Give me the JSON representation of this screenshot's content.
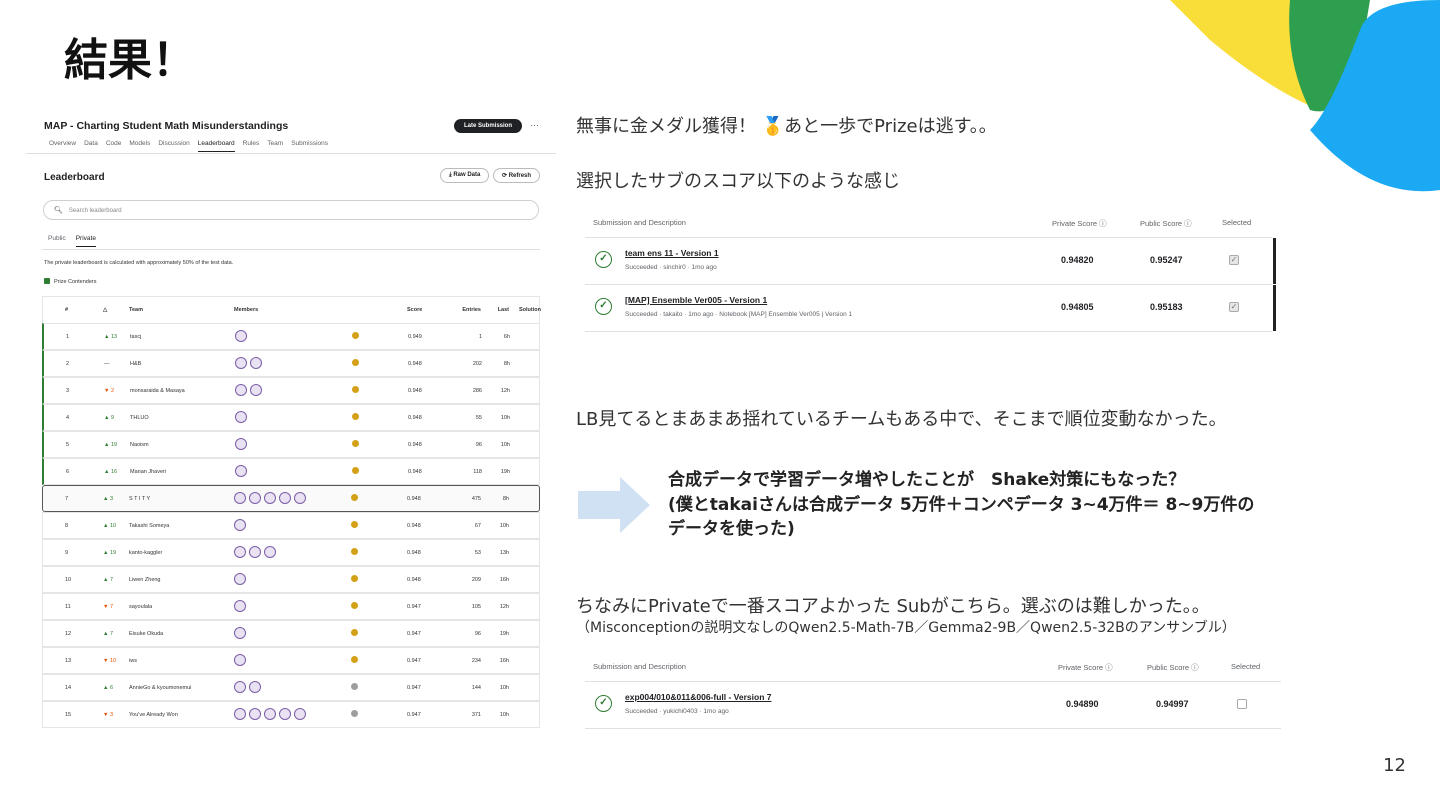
{
  "slide": {
    "title": "結果！",
    "page_number": "12"
  },
  "colors": {
    "yellow": "#f9de3a",
    "green": "#2e9e4f",
    "blue": "#1aa9f2",
    "arrow": "#cfe1f3",
    "prize_green": "#2e7d32"
  },
  "leaderboard": {
    "competition_title": "MAP - Charting Student Math Misunderstandings",
    "late_submission_label": "Late Submission",
    "more_label": "···",
    "tabs": [
      "Overview",
      "Data",
      "Code",
      "Models",
      "Discussion",
      "Leaderboard",
      "Rules",
      "Team",
      "Submissions"
    ],
    "active_tab": "Leaderboard",
    "heading": "Leaderboard",
    "raw_data_label": "⤓ Raw Data",
    "refresh_label": "⟳ Refresh",
    "search_placeholder": "Search leaderboard",
    "sub_tabs": [
      "Public",
      "Private"
    ],
    "note": "The private leaderboard is calculated with approximately 50% of the test data.",
    "prize_label": "Prize Contenders",
    "columns": [
      "#",
      "△",
      "Team",
      "Members",
      "Score",
      "Entries",
      "Last",
      "Solution"
    ],
    "rows": [
      {
        "rank": "1",
        "delta": "▲ 13",
        "dir": "up",
        "team": "tascj",
        "members": 1,
        "medal": "gold",
        "score": "0.949",
        "entries": "1",
        "last": "6h",
        "prize": true
      },
      {
        "rank": "2",
        "delta": "—",
        "dir": "none",
        "team": "H&B",
        "members": 2,
        "medal": "gold",
        "score": "0.948",
        "entries": "202",
        "last": "8h",
        "prize": true
      },
      {
        "rank": "3",
        "delta": "▼ 2",
        "dir": "down",
        "team": "monsaraida & Masaya",
        "members": 2,
        "medal": "gold",
        "score": "0.948",
        "entries": "286",
        "last": "12h",
        "prize": true
      },
      {
        "rank": "4",
        "delta": "▲ 9",
        "dir": "up",
        "team": "THLUO",
        "members": 1,
        "medal": "gold",
        "score": "0.948",
        "entries": "55",
        "last": "10h",
        "prize": true
      },
      {
        "rank": "5",
        "delta": "▲ 19",
        "dir": "up",
        "team": "Naoism",
        "members": 1,
        "medal": "gold",
        "score": "0.948",
        "entries": "96",
        "last": "10h",
        "prize": true
      },
      {
        "rank": "6",
        "delta": "▲ 16",
        "dir": "up",
        "team": "Manan Jhaveri",
        "members": 1,
        "medal": "gold",
        "score": "0.948",
        "entries": "118",
        "last": "19h",
        "prize": true
      },
      {
        "rank": "7",
        "delta": "▲ 3",
        "dir": "up",
        "team": "S T I T Y",
        "members": 5,
        "medal": "gold",
        "score": "0.948",
        "entries": "475",
        "last": "8h",
        "prize": false,
        "me": true
      },
      {
        "rank": "8",
        "delta": "▲ 10",
        "dir": "up",
        "team": "Takashi Someya",
        "members": 1,
        "medal": "gold",
        "score": "0.948",
        "entries": "67",
        "last": "10h",
        "prize": false
      },
      {
        "rank": "9",
        "delta": "▲ 19",
        "dir": "up",
        "team": "kanto-kaggler",
        "members": 3,
        "medal": "gold",
        "score": "0.948",
        "entries": "53",
        "last": "13h",
        "prize": false
      },
      {
        "rank": "10",
        "delta": "▲ 7",
        "dir": "up",
        "team": "Liwen Zheng",
        "members": 1,
        "medal": "gold",
        "score": "0.948",
        "entries": "209",
        "last": "16h",
        "prize": false
      },
      {
        "rank": "11",
        "delta": "▼ 7",
        "dir": "down",
        "team": "sayoulala",
        "members": 1,
        "medal": "gold",
        "score": "0.947",
        "entries": "105",
        "last": "12h",
        "prize": false
      },
      {
        "rank": "12",
        "delta": "▲ 7",
        "dir": "up",
        "team": "Eisuke Okuda",
        "members": 1,
        "medal": "gold",
        "score": "0.947",
        "entries": "96",
        "last": "19h",
        "prize": false
      },
      {
        "rank": "13",
        "delta": "▼ 10",
        "dir": "down",
        "team": "iws",
        "members": 1,
        "medal": "gold",
        "score": "0.947",
        "entries": "234",
        "last": "16h",
        "prize": false
      },
      {
        "rank": "14",
        "delta": "▲ 6",
        "dir": "up",
        "team": "AnnieGo & kyoumonemui",
        "members": 2,
        "medal": "silver",
        "score": "0.947",
        "entries": "144",
        "last": "10h",
        "prize": false
      },
      {
        "rank": "15",
        "delta": "▼ 3",
        "dir": "down",
        "team": "You've Already Won",
        "members": 5,
        "medal": "silver",
        "score": "0.947",
        "entries": "371",
        "last": "10h",
        "prize": false
      }
    ]
  },
  "texts": {
    "gold": "無事に金メダル獲得！ 🥇あと一歩でPrizeは逃す。。",
    "selected_intro": "選択したサブのスコア以下のような感じ",
    "shake": "LB見てるとまあまあ揺れているチームもある中で、そこまで順位変動なかった。",
    "bold_line1": "合成データで学習データ増やしたことが　Shake対策にもなった？",
    "bold_line2": "(僕とtakaiさんは合成データ 5万件＋コンペデータ 3~4万件＝ 8~9万件の",
    "bold_line3": "データを使った)",
    "best_intro": "ちなみにPrivateで一番スコアよかった Subがこちら。選ぶのは難しかった。。",
    "best_detail": "（Misconceptionの説明文なしのQwen2.5-Math-7B／Gemma2-9B／Qwen2.5-32Bのアンサンブル）"
  },
  "selected_table": {
    "headers": {
      "desc": "Submission and Description",
      "private": "Private Score ⓘ",
      "public": "Public Score ⓘ",
      "selected": "Selected"
    },
    "rows": [
      {
        "name": "team ens 11 - Version 1",
        "meta": "Succeeded · sinchir0 · 1mo ago",
        "private": "0.94820",
        "public": "0.95247",
        "selected": true
      },
      {
        "name": "[MAP] Ensemble Ver005 - Version 1",
        "meta": "Succeeded · takaito · 1mo ago · Notebook [MAP] Ensemble Ver005 | Version 1",
        "private": "0.94805",
        "public": "0.95183",
        "selected": true
      }
    ]
  },
  "best_table": {
    "headers": {
      "desc": "Submission and Description",
      "private": "Private Score ⓘ",
      "public": "Public Score ⓘ",
      "selected": "Selected"
    },
    "rows": [
      {
        "name": "exp004/010&011&006-full - Version 7",
        "meta": "Succeeded · yukichi0403 · 1mo ago",
        "private": "0.94890",
        "public": "0.94997",
        "selected": false
      }
    ]
  }
}
